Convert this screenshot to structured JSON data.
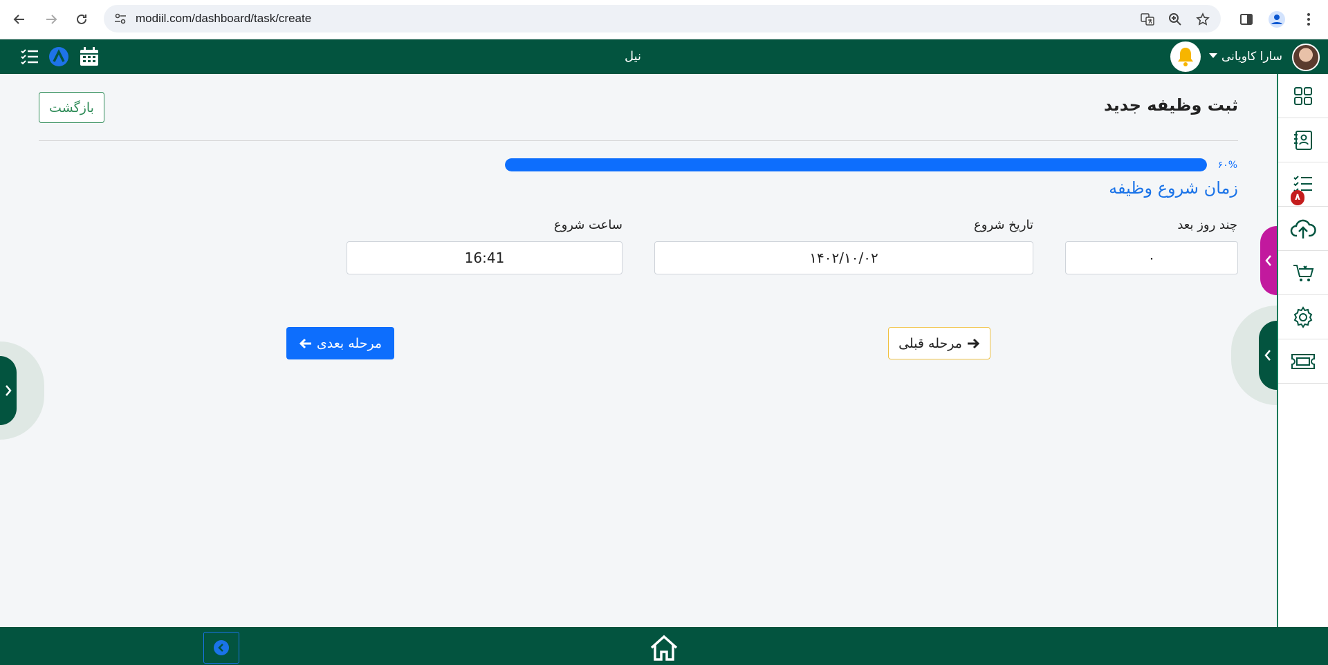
{
  "browser": {
    "url": "modiil.com/dashboard/task/create"
  },
  "app": {
    "brand": "نیل",
    "user_name": "سارا کاویانی"
  },
  "sidebar": {
    "items": [
      {
        "icon": "grid-icon"
      },
      {
        "icon": "contacts-book-icon"
      },
      {
        "icon": "task-list-icon",
        "badge": "۸"
      },
      {
        "icon": "cloud-upload-icon"
      },
      {
        "icon": "cart-icon"
      },
      {
        "icon": "gear-icon"
      },
      {
        "icon": "ticket-icon"
      }
    ]
  },
  "page": {
    "title": "ثبت وظیفه جدید",
    "back_label": "بازگشت",
    "progress_label": "۶۰%",
    "progress_value": 0.6,
    "section_title": "زمان شروع وظیفه"
  },
  "form": {
    "days_after": {
      "label": "چند روز بعد",
      "value": "۰"
    },
    "start_date": {
      "label": "تاریخ شروع",
      "value": "۱۴۰۲/۱۰/۰۲"
    },
    "start_time": {
      "label": "ساعت شروع",
      "value": "16:41"
    }
  },
  "actions": {
    "prev_label": "مرحله قبلی",
    "next_label": "مرحله بعدی"
  },
  "colors": {
    "brand_green": "#03543f",
    "primary_blue": "#0d6efd",
    "accent_magenta": "#c2199e"
  }
}
